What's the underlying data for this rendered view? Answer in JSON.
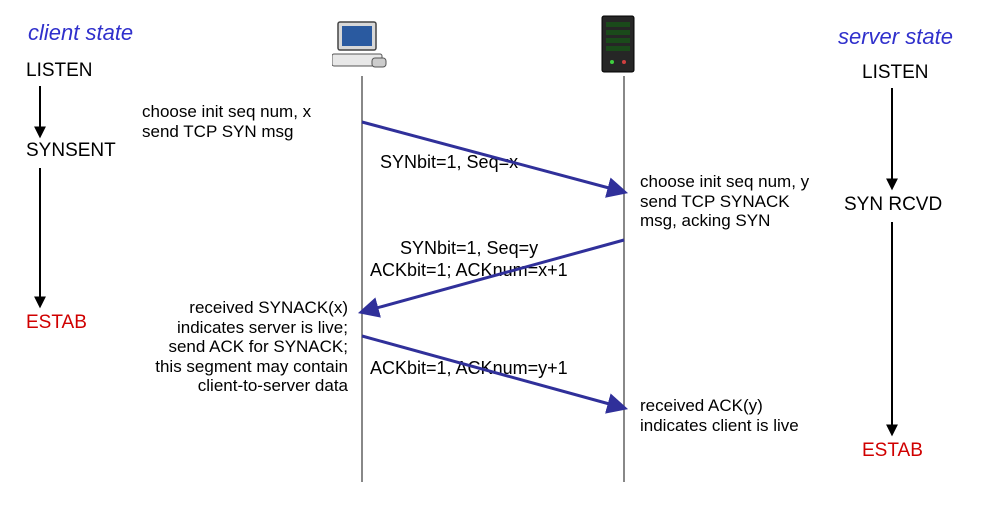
{
  "headers": {
    "client": "client state",
    "server": "server state"
  },
  "client_states": {
    "listen": "LISTEN",
    "synsent": "SYNSENT",
    "estab": "ESTAB"
  },
  "server_states": {
    "listen": "LISTEN",
    "synrcvd": "SYN RCVD",
    "estab": "ESTAB"
  },
  "notes": {
    "client_choose": "choose init seq num, x\nsend TCP SYN msg",
    "server_choose": "choose init seq num, y\nsend TCP SYNACK\nmsg, acking SYN",
    "client_received": "received SYNACK(x)\nindicates server is live;\nsend ACK for SYNACK;\nthis segment may contain\nclient-to-server data",
    "server_received": "received ACK(y)\nindicates client is live"
  },
  "messages": {
    "syn": "SYNbit=1, Seq=x",
    "synack_l1": "SYNbit=1, Seq=y",
    "synack_l2": "ACKbit=1; ACKnum=x+1",
    "ack": "ACKbit=1, ACKnum=y+1"
  },
  "icons": {
    "client": "computer-icon",
    "server": "server-icon"
  }
}
